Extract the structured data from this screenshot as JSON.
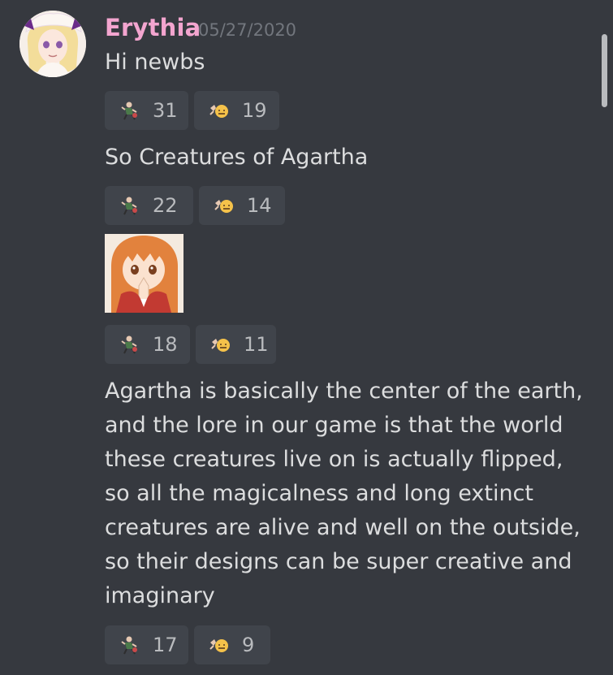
{
  "author": {
    "username": "Erythia",
    "timestamp": "05/27/2020",
    "name_color": "#f3a5cf"
  },
  "messages": [
    {
      "text": "Hi newbs",
      "reactions": [
        {
          "emoji": "dancing-character-emoji",
          "count": "31"
        },
        {
          "emoji": "flex-face-emoji",
          "count": "19"
        }
      ]
    },
    {
      "text": "So Creatures of Agartha",
      "reactions": [
        {
          "emoji": "dancing-character-emoji",
          "count": "22"
        },
        {
          "emoji": "flex-face-emoji",
          "count": "14"
        }
      ]
    },
    {
      "attachment": "anime-girl-praying-image",
      "reactions": [
        {
          "emoji": "dancing-character-emoji",
          "count": "18"
        },
        {
          "emoji": "flex-face-emoji",
          "count": "11"
        }
      ]
    },
    {
      "text": "Agartha is basically the center of the earth, and the lore in our game is that the world these creatures live on is actually flipped, so all the magicalness and long extinct creatures are alive and well on the outside, so their designs can be super creative and imaginary",
      "reactions": [
        {
          "emoji": "dancing-character-emoji",
          "count": "17"
        },
        {
          "emoji": "flex-face-emoji",
          "count": "9"
        }
      ]
    }
  ],
  "colors": {
    "background": "#36393f",
    "reaction_bg": "#40444b",
    "text": "#dcddde",
    "muted": "#72767d"
  }
}
